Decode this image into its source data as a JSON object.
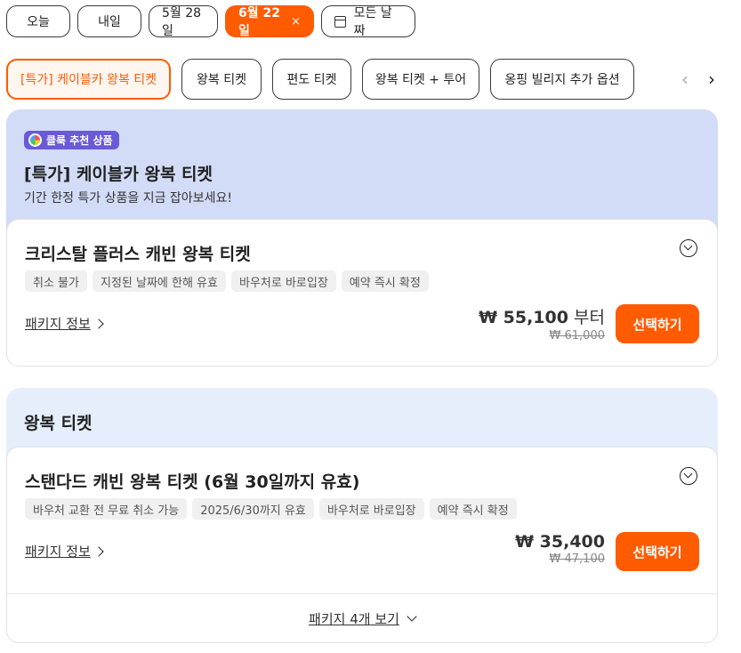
{
  "date_filters": [
    {
      "label": "오늘"
    },
    {
      "label": "내일"
    },
    {
      "label": "5월 28일"
    },
    {
      "label": "6월 22일",
      "selected": true,
      "clear_icon": "×"
    },
    {
      "label": "모든 날짜",
      "icon": "calendar-icon"
    }
  ],
  "package_filters": [
    {
      "label": "[특가] 케이블카 왕복 티켓",
      "selected": true
    },
    {
      "label": "왕복 티켓"
    },
    {
      "label": "편도 티켓"
    },
    {
      "label": "왕복 티켓 + 투어"
    },
    {
      "label": "옹핑 빌리지 추가 옵션"
    }
  ],
  "nav": {
    "prev": "‹",
    "next": "›"
  },
  "sections": [
    {
      "badge": "클룩 추천 상품",
      "title": "[특가] 케이블카 왕복 티켓",
      "subtitle": "기간 한정 특가 상품을 지금 잡아보세요!",
      "card": {
        "title": "크리스탈 플러스 캐빈 왕복 티켓",
        "tags": [
          "취소 불가",
          "지정된 날짜에 한해 유효",
          "바우처로 바로입장",
          "예약 즉시 확정"
        ],
        "package_info": "패키지 정보",
        "price": "₩ 55,100",
        "price_suffix": "부터",
        "original_price": "₩ 61,000",
        "select": "선택하기"
      }
    },
    {
      "title": "왕복 티켓",
      "card": {
        "title": "스탠다드 캐빈 왕복 티켓 (6월 30일까지 유효)",
        "tags": [
          "바우처 교환 전 무료 취소 가능",
          "2025/6/30까지 유효",
          "바우처로 바로입장",
          "예약 즉시 확정"
        ],
        "package_info": "패키지 정보",
        "price": "₩ 35,400",
        "original_price": "₩ 47,100",
        "select": "선택하기",
        "more": "패키지 4개 보기"
      }
    }
  ],
  "colors": {
    "accent": "#ff5b00",
    "featured_bg": "#d2dcf7",
    "section_bg": "#e6eefc",
    "badge": "#6a5ad9"
  }
}
